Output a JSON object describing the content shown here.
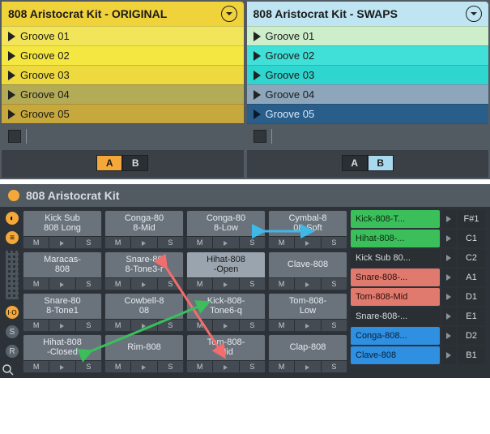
{
  "tracks": [
    {
      "title": "808 Aristocrat Kit - ORIGINAL",
      "header_bg": "#f0d23a",
      "clips": [
        {
          "label": "Groove 01",
          "bg": "#f2e55a"
        },
        {
          "label": "Groove 02",
          "bg": "#f5e742"
        },
        {
          "label": "Groove 03",
          "bg": "#eed93f"
        },
        {
          "label": "Groove 04",
          "bg": "#b3ab56"
        },
        {
          "label": "Groove 05",
          "bg": "#c7a83c",
          "selected": false
        }
      ],
      "ab": {
        "A": "A",
        "B": "B",
        "active": "A",
        "active_class": "active-orange"
      }
    },
    {
      "title": "808 Aristocrat Kit - SWAPS",
      "header_bg": "#bfe5f2",
      "clips": [
        {
          "label": "Groove 01",
          "bg": "#cdeecb"
        },
        {
          "label": "Groove 02",
          "bg": "#40e0d8"
        },
        {
          "label": "Groove 03",
          "bg": "#2fd6cf"
        },
        {
          "label": "Groove 04",
          "bg": "#8ea6bb"
        },
        {
          "label": "Groove 05",
          "bg": "#2a5e8a",
          "selected": true
        }
      ],
      "ab": {
        "A": "A",
        "B": "B",
        "active": "B",
        "active_class": "active-blue"
      }
    }
  ],
  "device": {
    "title": "808 Aristocrat Kit",
    "pads": [
      [
        {
          "label": "Kick Sub\n808 Long"
        },
        {
          "label": "Conga-80\n8-Mid"
        },
        {
          "label": "Conga-80\n8-Low"
        },
        {
          "label": "Cymbal-8\n08-Soft"
        }
      ],
      [
        {
          "label": "Maracas-\n808"
        },
        {
          "label": "Snare-80\n8-Tone3-r"
        },
        {
          "label": "Hihat-808\n-Open",
          "selected": true
        },
        {
          "label": "Clave-808"
        }
      ],
      [
        {
          "label": "Snare-80\n8-Tone1"
        },
        {
          "label": "Cowbell-8\n08"
        },
        {
          "label": "Kick-808-\nTone6-q"
        },
        {
          "label": "Tom-808-\nLow"
        }
      ],
      [
        {
          "label": "Hihat-808\n-Closed"
        },
        {
          "label": "Rim-808"
        },
        {
          "label": "Tom-808-\nMid"
        },
        {
          "label": "Clap-808"
        }
      ]
    ],
    "pad_controls": {
      "M": "M",
      "S": "S"
    },
    "chains": [
      {
        "name": "Kick-808-T...",
        "note": "F#1",
        "bg": "#3bbf5a",
        "fg": "#0b2a12"
      },
      {
        "name": "Hihat-808-...",
        "note": "C1",
        "bg": "#3bbf5a",
        "fg": "#0b2a12"
      },
      {
        "name": "Kick Sub 80...",
        "note": "C2",
        "bg": "#2a2f34",
        "fg": "#d8dde2"
      },
      {
        "name": "Snare-808-...",
        "note": "A1",
        "bg": "#e07a6e",
        "fg": "#2a0f0c"
      },
      {
        "name": "Tom-808-Mid",
        "note": "D1",
        "bg": "#e07a6e",
        "fg": "#2a0f0c"
      },
      {
        "name": "Snare-808-...",
        "note": "E1",
        "bg": "#2a2f34",
        "fg": "#d8dde2"
      },
      {
        "name": "Conga-808...",
        "note": "D2",
        "bg": "#2f8fe0",
        "fg": "#08223d"
      },
      {
        "name": "Clave-808",
        "note": "B1",
        "bg": "#2f8fe0",
        "fg": "#08223d"
      }
    ],
    "side_labels": {
      "io": "I·O",
      "s": "S",
      "r": "R"
    }
  }
}
